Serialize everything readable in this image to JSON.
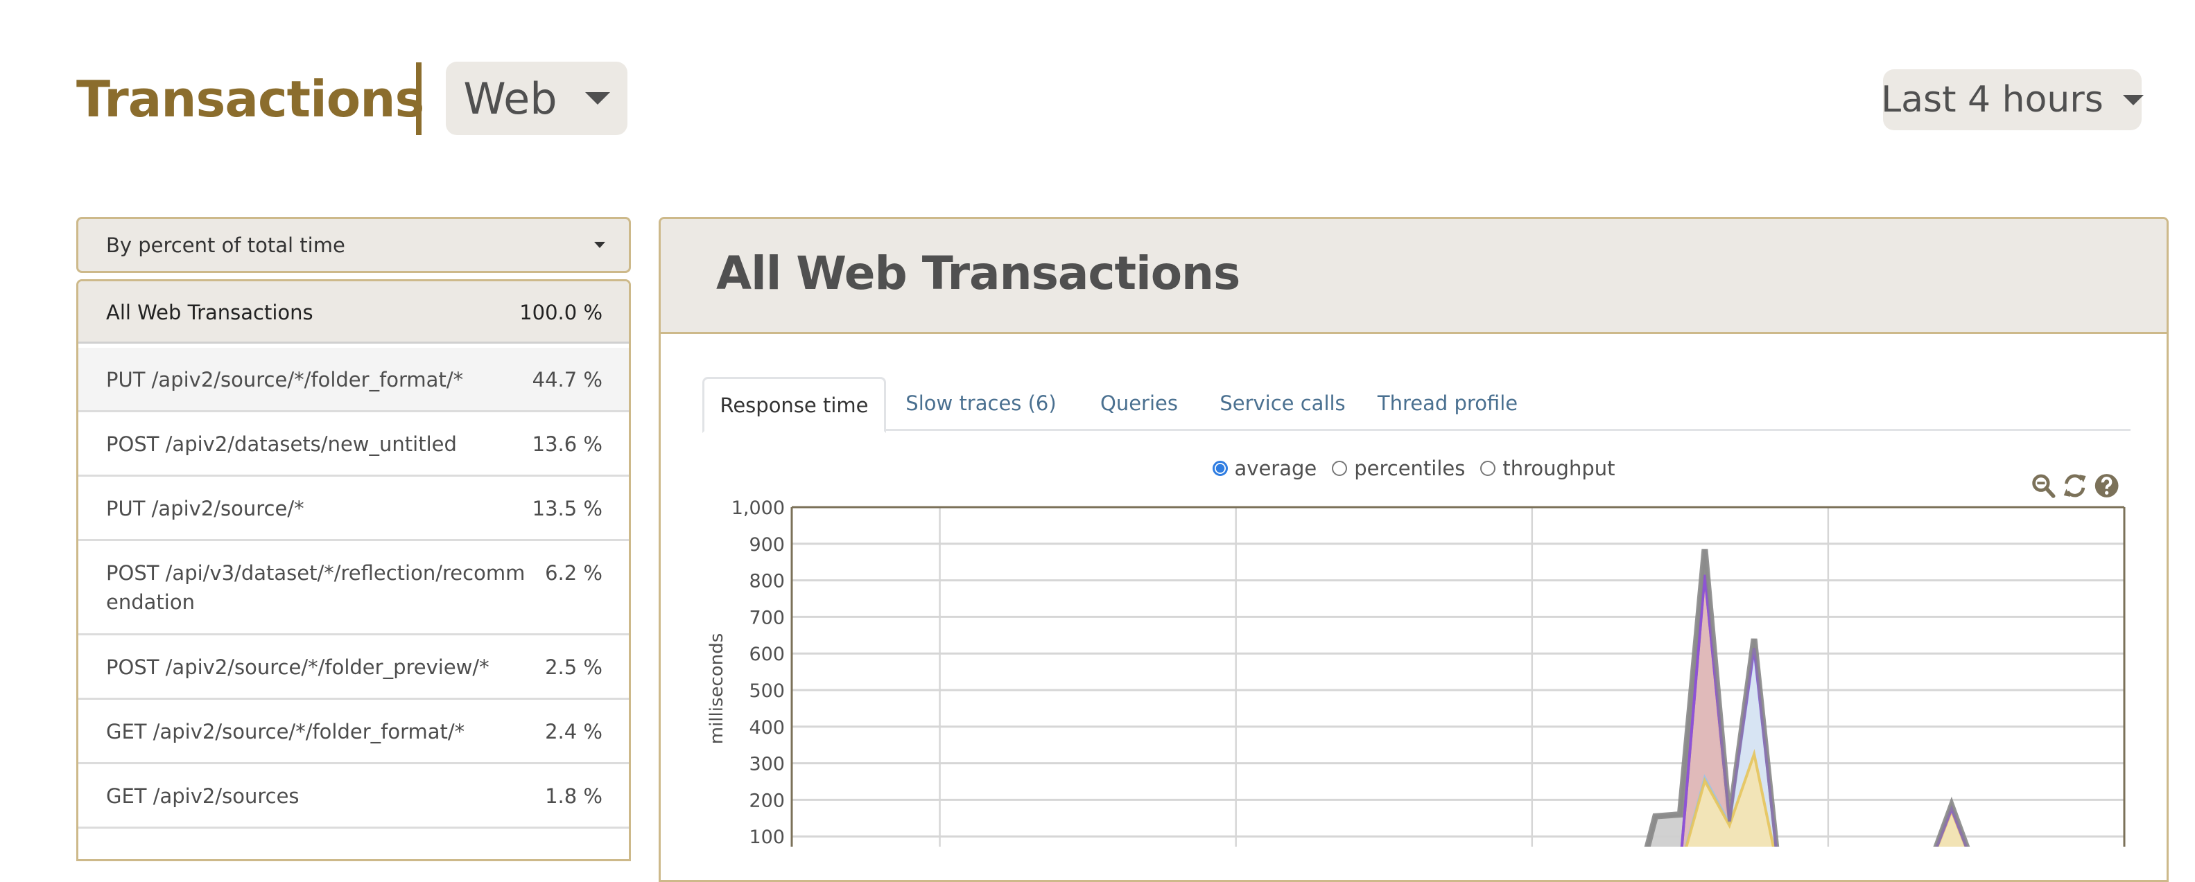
{
  "header": {
    "title": "Transactions",
    "type_selector": {
      "value": "Web",
      "icon": "caret-down-icon"
    },
    "time_range": {
      "value": "Last 4 hours",
      "icon": "caret-down-icon"
    }
  },
  "sidebar": {
    "sort_dropdown": {
      "value": "By percent of total time",
      "icon": "caret-down-icon"
    },
    "transactions": [
      {
        "name": "All Web Transactions",
        "percent": "100.0 %"
      },
      {
        "name": "PUT /apiv2/source/*/folder_format/*",
        "percent": "44.7 %"
      },
      {
        "name": "POST /apiv2/datasets/new_untitled",
        "percent": "13.6 %"
      },
      {
        "name": "PUT /apiv2/source/*",
        "percent": "13.5 %"
      },
      {
        "name": "POST /api/v3/dataset/*/reflection/recommendation",
        "percent": "6.2 %"
      },
      {
        "name": "POST /apiv2/source/*/folder_preview/*",
        "percent": "2.5 %"
      },
      {
        "name": "GET /apiv2/source/*/folder_format/*",
        "percent": "2.4 %"
      },
      {
        "name": "GET /apiv2/sources",
        "percent": "1.8 %"
      }
    ]
  },
  "detail": {
    "title": "All Web Transactions",
    "tabs": [
      {
        "label": "Response time",
        "active": true
      },
      {
        "label": "Slow traces (6)",
        "active": false
      },
      {
        "label": "Queries",
        "active": false
      },
      {
        "label": "Service calls",
        "active": false
      },
      {
        "label": "Thread profile",
        "active": false
      }
    ],
    "modes": [
      {
        "label": "average",
        "checked": true
      },
      {
        "label": "percentiles",
        "checked": false
      },
      {
        "label": "throughput",
        "checked": false
      }
    ],
    "tools": [
      "zoom-out-icon",
      "refresh-icon",
      "help-icon"
    ]
  },
  "colors": {
    "brand": "#8b6d2d",
    "panel_border": "#cdb98a",
    "panel_bg": "#ece9e4",
    "link": "#4a7090",
    "radio_on": "#2f7de1",
    "tool_icon": "#7b7159"
  },
  "chart_data": {
    "type": "area",
    "title": "",
    "xlabel": "",
    "ylabel": "milliseconds",
    "ylim": [
      0,
      1000
    ],
    "yticks": [
      "1,000",
      "900",
      "800",
      "700",
      "600",
      "500",
      "400",
      "300",
      "200",
      "100"
    ],
    "ytick_values": [
      1000,
      900,
      800,
      700,
      600,
      500,
      400,
      300,
      200,
      100
    ],
    "grid": true,
    "x_index_range": [
      0,
      54
    ],
    "x_gridline_indices": [
      6,
      18,
      30,
      42
    ],
    "stacked": true,
    "series": [
      {
        "name": "series-yellow",
        "color": "#f3e4b3",
        "stroke": "#e6c45c",
        "points": [
          [
            35,
            0
          ],
          [
            36,
            10
          ],
          [
            37,
            252
          ],
          [
            38,
            130
          ],
          [
            39,
            325
          ],
          [
            40,
            0
          ],
          [
            46,
            0
          ],
          [
            47,
            170
          ],
          [
            48,
            0
          ]
        ]
      },
      {
        "name": "series-blue",
        "color": "#d6e6f5",
        "stroke": "#9cc3e6",
        "points": [
          [
            35,
            0
          ],
          [
            36,
            12
          ],
          [
            37,
            260
          ],
          [
            38,
            135
          ],
          [
            39,
            612
          ],
          [
            40,
            0
          ]
        ]
      },
      {
        "name": "series-red",
        "color": "#e0b8b8",
        "stroke": "#b07070",
        "points": [
          [
            35,
            0
          ],
          [
            36,
            15
          ],
          [
            37,
            815
          ],
          [
            38,
            140
          ],
          [
            39,
            612
          ],
          [
            40,
            0
          ]
        ]
      },
      {
        "name": "series-purple",
        "color": "none",
        "stroke": "#8a4fe0",
        "points": [
          [
            35,
            0
          ],
          [
            36,
            15
          ],
          [
            37,
            815
          ],
          [
            38,
            142
          ],
          [
            39,
            615
          ],
          [
            40,
            0
          ],
          [
            46,
            0
          ],
          [
            47,
            175
          ],
          [
            48,
            0
          ]
        ]
      },
      {
        "name": "series-gray-total",
        "color": "#cfcfcf",
        "stroke": "#888888",
        "points": [
          [
            34.4,
            0
          ],
          [
            35,
            155
          ],
          [
            36,
            160
          ],
          [
            37,
            885
          ],
          [
            38,
            140
          ],
          [
            39,
            640
          ],
          [
            40,
            0
          ],
          [
            46,
            0
          ],
          [
            47,
            184
          ],
          [
            48,
            0
          ]
        ]
      }
    ]
  }
}
